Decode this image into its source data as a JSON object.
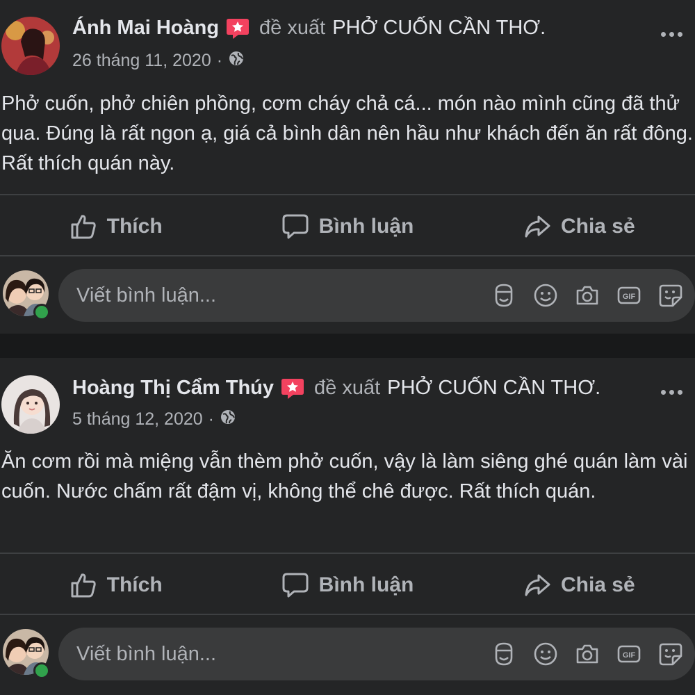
{
  "posts": [
    {
      "author": "Ánh Mai Hoàng",
      "verb": "đề xuất",
      "page": "PHỞ CUỐN CẦN THƠ.",
      "date": "26 tháng 11, 2020",
      "dot": "·",
      "text": "Phở cuốn, phở chiên phồng, cơm cháy chả cá... món nào mình cũng đã thử qua. Đúng là rất ngon ạ, giá cả bình dân nên hầu như khách đến ăn rất đông. Rất thích quán này.",
      "actions": {
        "like": "Thích",
        "comment": "Bình luận",
        "share": "Chia sẻ"
      },
      "comment_placeholder": "Viết bình luận..."
    },
    {
      "author": "Hoàng Thị Cẩm Thúy",
      "verb": "đề xuất",
      "page": "PHỞ CUỐN CẦN THƠ.",
      "date": "5 tháng 12, 2020",
      "dot": "·",
      "text": "Ăn cơm rồi mà miệng vẫn thèm phở cuốn, vậy là làm siêng ghé quán làm vài cuốn. Nước chấm rất đậm vị, không thể chê được. Rất thích quán.",
      "actions": {
        "like": "Thích",
        "comment": "Bình luận",
        "share": "Chia sẻ"
      },
      "comment_placeholder": "Viết bình luận..."
    }
  ],
  "icons": {
    "recommend": "recommend-star-icon",
    "privacy": "globe-icon",
    "more": "more-options-icon",
    "like": "thumbs-up-icon",
    "comment": "comment-bubble-icon",
    "share": "share-arrow-icon",
    "tools": [
      "avatar-sticker-icon",
      "emoji-icon",
      "camera-icon",
      "gif-icon",
      "sticker-icon"
    ]
  },
  "colors": {
    "background": "#18191a",
    "card": "#242526",
    "input": "#3a3b3c",
    "text_primary": "#e4e6eb",
    "text_secondary": "#b0b3b8",
    "recommend_badge": "#f3425f",
    "online": "#31a24c"
  }
}
